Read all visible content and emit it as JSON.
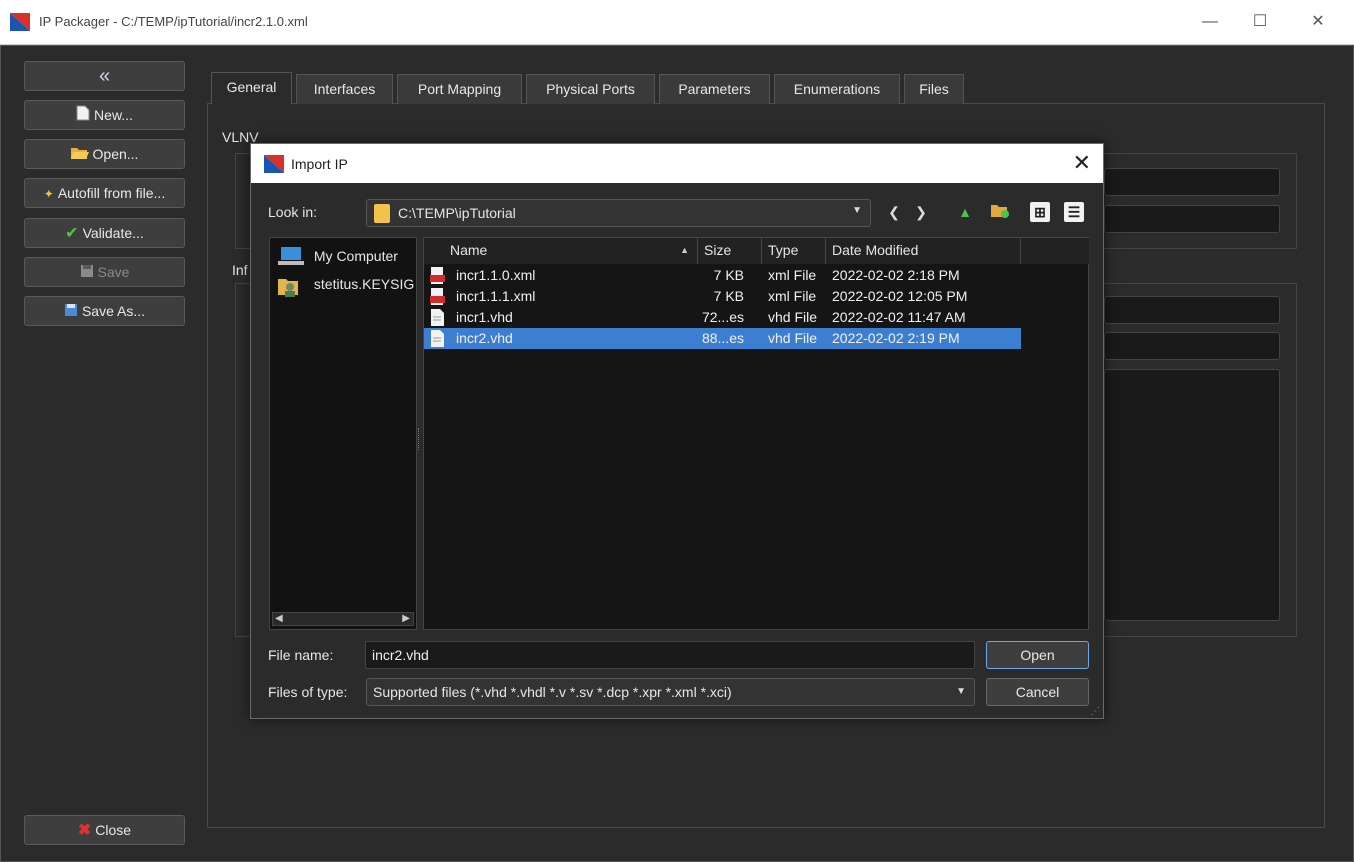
{
  "window": {
    "title": "IP Packager - C:/TEMP/ipTutorial/incr2.1.0.xml",
    "minimize": "—",
    "maximize": "☐",
    "close": "✕"
  },
  "sidebar": {
    "collapse_icon": "«",
    "new_label": "New...",
    "open_label": "Open...",
    "autofill_label": "Autofill from file...",
    "validate_label": "Validate...",
    "save_label": "Save",
    "saveas_label": "Save As...",
    "close_label": "Close"
  },
  "tabs": [
    "General",
    "Interfaces",
    "Port Mapping",
    "Physical Ports",
    "Parameters",
    "Enumerations",
    "Files"
  ],
  "general": {
    "vlnv_label": "VLNV",
    "info_label": "Inf"
  },
  "dialog": {
    "title": "Import IP",
    "close": "✕",
    "lookin_label": "Look in:",
    "lookin_value": "C:\\TEMP\\ipTutorial",
    "places": [
      "My Computer",
      "stetitus.KEYSIG"
    ],
    "columns": {
      "name": "Name",
      "size": "Size",
      "type": "Type",
      "date": "Date Modified"
    },
    "files": [
      {
        "name": "incr1.1.0.xml",
        "size": "7 KB",
        "type": "xml File",
        "date": "2022-02-02 2:18 PM",
        "icon": "xml-file-icon"
      },
      {
        "name": "incr1.1.1.xml",
        "size": "7 KB",
        "type": "xml File",
        "date": "2022-02-02 12:05 PM",
        "icon": "xml-file-icon"
      },
      {
        "name": "incr1.vhd",
        "size": "72...es",
        "type": "vhd File",
        "date": "2022-02-02 11:47 AM",
        "icon": "text-file-icon"
      },
      {
        "name": "incr2.vhd",
        "size": "88...es",
        "type": "vhd File",
        "date": "2022-02-02 2:19 PM",
        "icon": "text-file-icon",
        "selected": true
      }
    ],
    "filename_label": "File name:",
    "filename_value": "incr2.vhd",
    "filetype_label": "Files of type:",
    "filetype_value": "Supported files (*.vhd *.vhdl *.v *.sv *.dcp *.xpr *.xml *.xci)",
    "open_button": "Open",
    "cancel_button": "Cancel"
  },
  "colors": {
    "selection": "#3c7fd1",
    "background": "#2b2b2b",
    "accent_red": "#d9302a",
    "accent_blue": "#1a56b0"
  }
}
